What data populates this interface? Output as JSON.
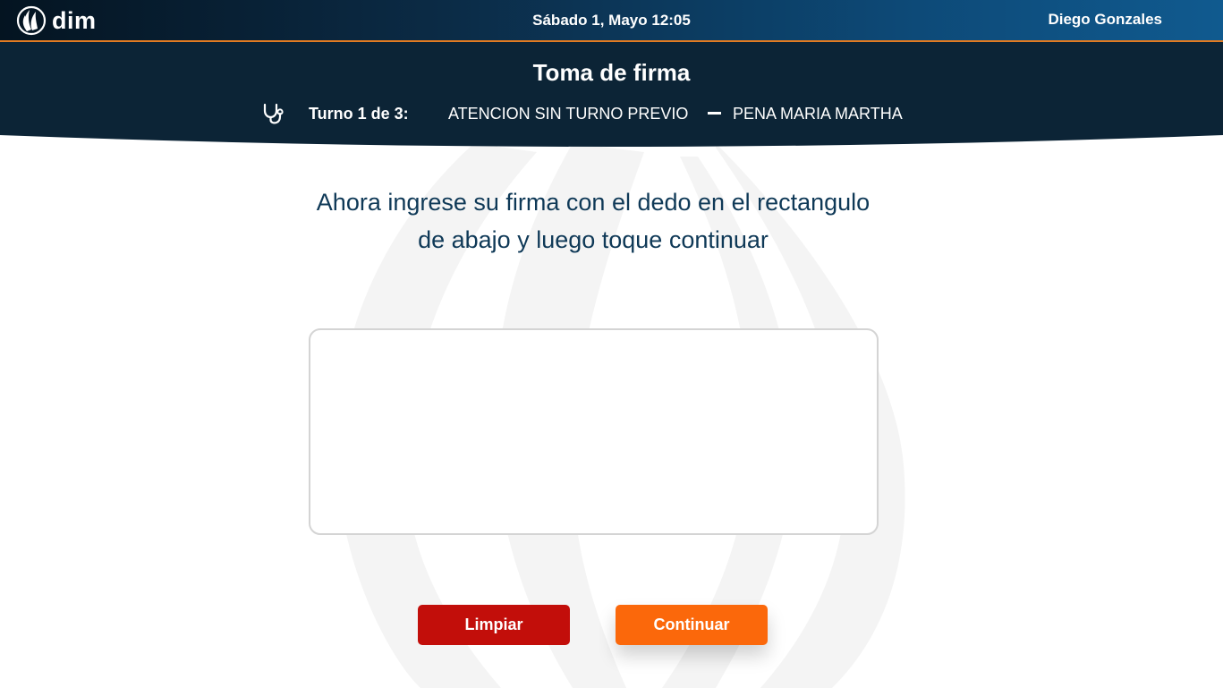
{
  "topbar": {
    "logo_text": "dim",
    "date": "Sábado 1, Mayo",
    "time": "12:05",
    "user_name": "Diego Gonzales"
  },
  "header": {
    "title": "Toma de firma",
    "turno_label": "Turno 1 de 3:",
    "turno_type": "ATENCION SIN TURNO PREVIO",
    "doctor_name": "PENA MARIA MARTHA"
  },
  "main": {
    "instruction_line1": "Ahora ingrese su firma con el dedo en el rectangulo",
    "instruction_line2": "de abajo y luego toque continuar"
  },
  "buttons": {
    "clear_label": "Limpiar",
    "continue_label": "Continuar"
  },
  "colors": {
    "topbar_dark": "#041421",
    "topbar_light": "#105a8f",
    "header_bg": "#0c2436",
    "accent_line": "#e27b22",
    "clear_button": "#c20e0a",
    "continue_button": "#fb680b",
    "instruction_text": "#0f3957"
  },
  "icons": {
    "logo": "flame-logo-icon",
    "turno": "stethoscope-icon"
  }
}
